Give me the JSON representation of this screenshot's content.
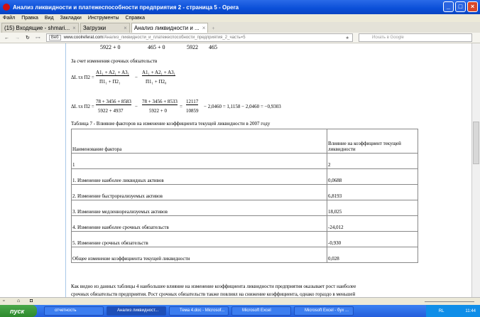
{
  "window": {
    "title": "Анализ ликвидности и платежеспособности предприятия 2 - страница 5 - Opera"
  },
  "menu": [
    "Файл",
    "Правка",
    "Вид",
    "Закладки",
    "Инструменты",
    "Справка"
  ],
  "tabs": [
    {
      "label": "(15) Входящие - shmari..."
    },
    {
      "label": "Загрузки"
    },
    {
      "label": "Анализ ликвидности и ..."
    }
  ],
  "address": {
    "badge": "Веб",
    "domain": "www.coolreferat.com",
    "path": "/Анализ_ликвидности_и_платежеспособности_предприятия_2_часть=5",
    "search_placeholder": "Искать в Google"
  },
  "content": {
    "prev_row": [
      "5922 + 0",
      "465 + 0",
      "5922",
      "465"
    ],
    "heading": "За счет изменения срочных обязательств",
    "formula1": "ΔL<sub>тл</sub><sup>П2</sup> = (A1₁ + A2₁ + A3₁)/(П1₁ + П2₁) − (A1₁ + A2₁ + A3₁)/(П1₁ + П2₀)",
    "f1_lhs": "ΔL тл П2 =",
    "f1_n1": "A1₁ + A2₁ + A3₁",
    "f1_d1": "П1₁ + П2₁",
    "f1_n2": "A1₁ + A2₁ + A3₁",
    "f1_d2": "П1₁ + П2₀",
    "f2_lhs": "ΔL тл П2 =",
    "f2_n1": "78 + 3456 + 8583",
    "f2_d1": "5922 + 4937",
    "f2_n2": "78 + 3456 + 8533",
    "f2_d2": "5922 + 0",
    "f2_n3": "12117",
    "f2_d3": "10859",
    "f2_tail": "− 2,0460 = 1,1158 − 2,0460 = −0,9303",
    "table_caption": "Таблица 7 - Влияние факторов на изменение коэффициента текущей ликвидности в 2007 году",
    "table": {
      "headers": [
        "Наименование фактора",
        "Влияние на коэффициент текущей ликвидности"
      ],
      "rows": [
        [
          "1",
          "2"
        ],
        [
          "1. Изменение наиболее ликвидных активов",
          "0,0688"
        ],
        [
          "2. Изменение быстрореализуемых активов",
          "6,8193"
        ],
        [
          "3. Изменение медленнореализуемых активов",
          "18,025"
        ],
        [
          "4. Изменение наиболее срочных обязательств",
          "-24,012"
        ],
        [
          "5. Изменение срочных обязательств",
          "-0,930"
        ],
        [
          "Общее изменение коэффициента текущей ликвидности",
          "0,028"
        ]
      ]
    },
    "para1": "Как видно из данных таблицы 4 наибольшее влияние на изменение коэффициента ликвидности предприятия оказывает рост наиболее",
    "para2": "срочных обязательств предприятия. Рост срочных обязательств также повлиял на снижение коэффициента, однако гораздо в меньшей"
  },
  "taskbar": {
    "start": "пуск",
    "tasks": [
      "отчетность",
      "Анализ ликвидност...",
      "Тема 4.doc - Microsof...",
      "Microsoft Excel",
      "Microsoft Excel - бух ..."
    ],
    "lang": "RL",
    "time": "11:44"
  }
}
